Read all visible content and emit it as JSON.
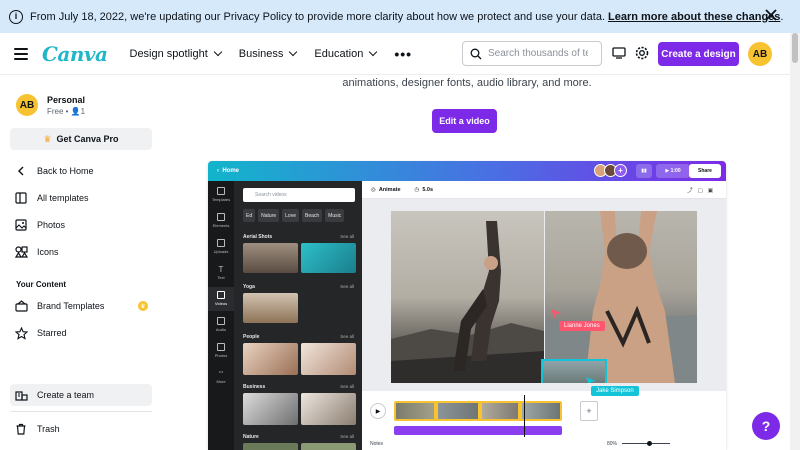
{
  "banner": {
    "text": "From July 18, 2022, we're updating our Privacy Policy to provide more clarity about how we protect and use your data.",
    "link": "Learn more about these changes",
    "tail": "."
  },
  "header": {
    "logo": "Canva",
    "nav": [
      "Design spotlight",
      "Business",
      "Education"
    ],
    "more": "•••",
    "search_placeholder": "Search thousands of templates",
    "create_label": "Create a design",
    "avatar_initials": "AB"
  },
  "sidebar": {
    "account_name": "Personal",
    "account_sub": "Free • 👤1",
    "avatar_initials": "AB",
    "pro_label": "Get Canva Pro",
    "items": [
      {
        "label": "Back to Home"
      },
      {
        "label": "All templates"
      },
      {
        "label": "Photos"
      },
      {
        "label": "Icons"
      }
    ],
    "section_title": "Your Content",
    "content_items": [
      {
        "label": "Brand Templates"
      },
      {
        "label": "Starred"
      }
    ],
    "team_label": "Create a team",
    "trash_label": "Trash"
  },
  "main": {
    "lead": "animations, designer fonts, audio library, and more.",
    "edit_label": "Edit a video"
  },
  "editor": {
    "home": "Home",
    "duration_chip": "1:00",
    "share_chip": "Share",
    "rail": [
      "Templates",
      "Elements",
      "Uploads",
      "Text",
      "Videos",
      "Audio",
      "Photos",
      "More"
    ],
    "search_placeholder": "Search videos",
    "tags": [
      "Ed",
      "Nature",
      "Love",
      "Beach",
      "Music"
    ],
    "sections": [
      "Aerial Shots",
      "Yoga",
      "People",
      "Business",
      "Nature"
    ],
    "see_all": "See all",
    "animate": "Animate",
    "time": "5.0s",
    "collaborator_1": "Lianne Jones",
    "collaborator_2": "Jake Simpson",
    "notes": "Notes",
    "zoom": "80%"
  },
  "help_label": "?",
  "colors": {
    "brand_purple": "#7d2ae8",
    "banner_bg": "#d6e9fb",
    "logo_teal": "#21b6c8",
    "avatar_yellow": "#f7c331"
  }
}
